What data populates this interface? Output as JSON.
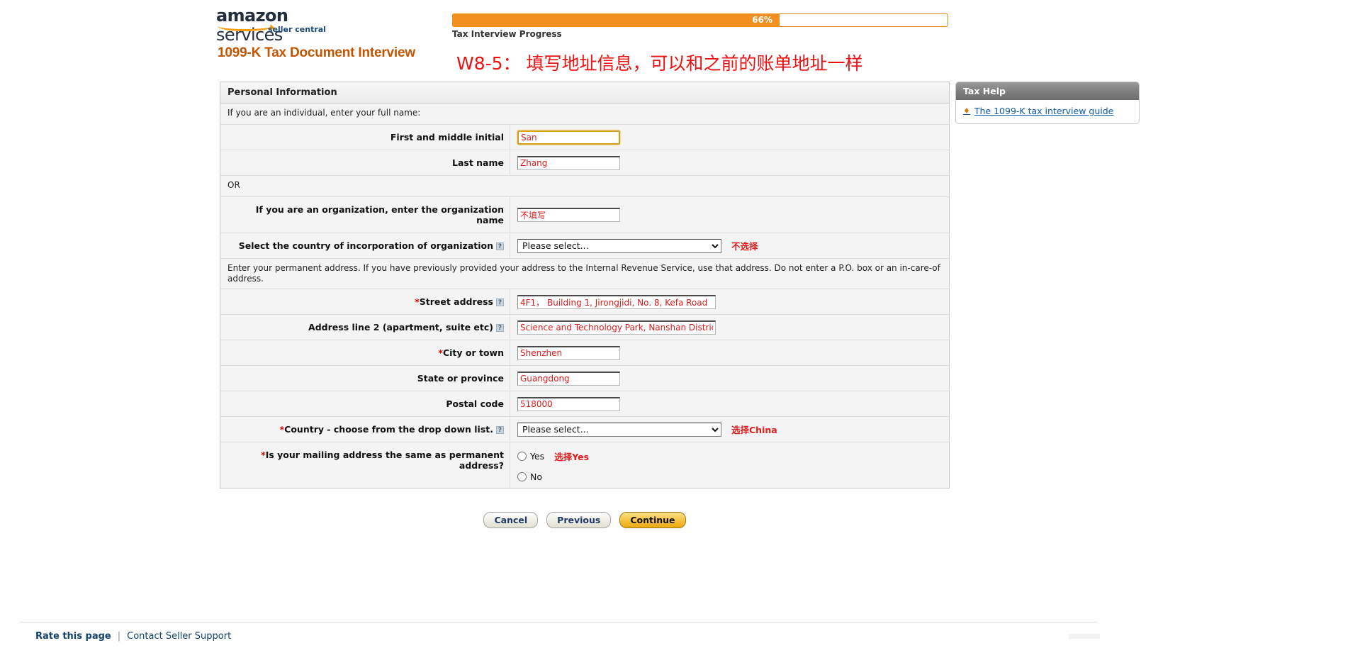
{
  "brand": {
    "logo_main": "amazon",
    "logo_services": " services",
    "logo_tm": "™",
    "logo_sub": "seller central"
  },
  "header": {
    "page_title": "1099-K Tax Document Interview",
    "annotation_cn": "W8-5： 填写地址信息，可以和之前的账单地址一样"
  },
  "progress": {
    "percent_label": "66%",
    "percent_value": 66,
    "caption": "Tax Interview Progress",
    "fill_color": "#f19021"
  },
  "form": {
    "section_title": "Personal Information",
    "intro_individual": "If you are an individual, enter your full name:",
    "or_text": "OR",
    "address_note": "Enter your permanent address. If you have previously provided your address to the Internal Revenue Service, use that address. Do not enter a P.O. box or an in-care-of address.",
    "fields": {
      "first_name": {
        "label": "First and middle initial",
        "value": "San"
      },
      "last_name": {
        "label": "Last name",
        "value": "Zhang"
      },
      "org_name": {
        "label": "If you are an organization, enter the organization name",
        "value": "不填写"
      },
      "org_country": {
        "label": "Select the country of incorporation of organization",
        "selected": "Please select...",
        "options": [
          "Please select..."
        ],
        "annotation_cn": "不选择",
        "help_glyph": "?"
      },
      "street_address": {
        "label_required": "*",
        "label": "Street address",
        "value": "4F1， Building 1, Jirongjidi, No. 8, Kefa Road",
        "help_glyph": "?"
      },
      "address_line2": {
        "label": "Address line 2 (apartment, suite etc)",
        "value": "Science and Technology Park, Nanshan District",
        "help_glyph": "?"
      },
      "city": {
        "label_required": "*",
        "label": "City or town",
        "value": "Shenzhen"
      },
      "state": {
        "label": "State or province",
        "value": "Guangdong"
      },
      "postal": {
        "label": "Postal code",
        "value": "518000"
      },
      "country": {
        "label_required": "*",
        "label": "Country - choose from the drop down list.",
        "selected": "Please select...",
        "options": [
          "Please select..."
        ],
        "annotation_cn": "选择China",
        "help_glyph": "?"
      },
      "mailing_same": {
        "label_required": "*",
        "label": "Is your mailing address the same as permanent address?",
        "option_yes": "Yes",
        "option_no": "No",
        "annotation_cn": "选择Yes"
      }
    }
  },
  "buttons": {
    "cancel": "Cancel",
    "previous": "Previous",
    "continue": "Continue"
  },
  "tax_help": {
    "title": "Tax Help",
    "bullet_glyph": "♦",
    "link": "The 1099-K tax interview guide"
  },
  "footer": {
    "rate": "Rate this page",
    "separator": "|",
    "contact": "Contact Seller Support"
  }
}
